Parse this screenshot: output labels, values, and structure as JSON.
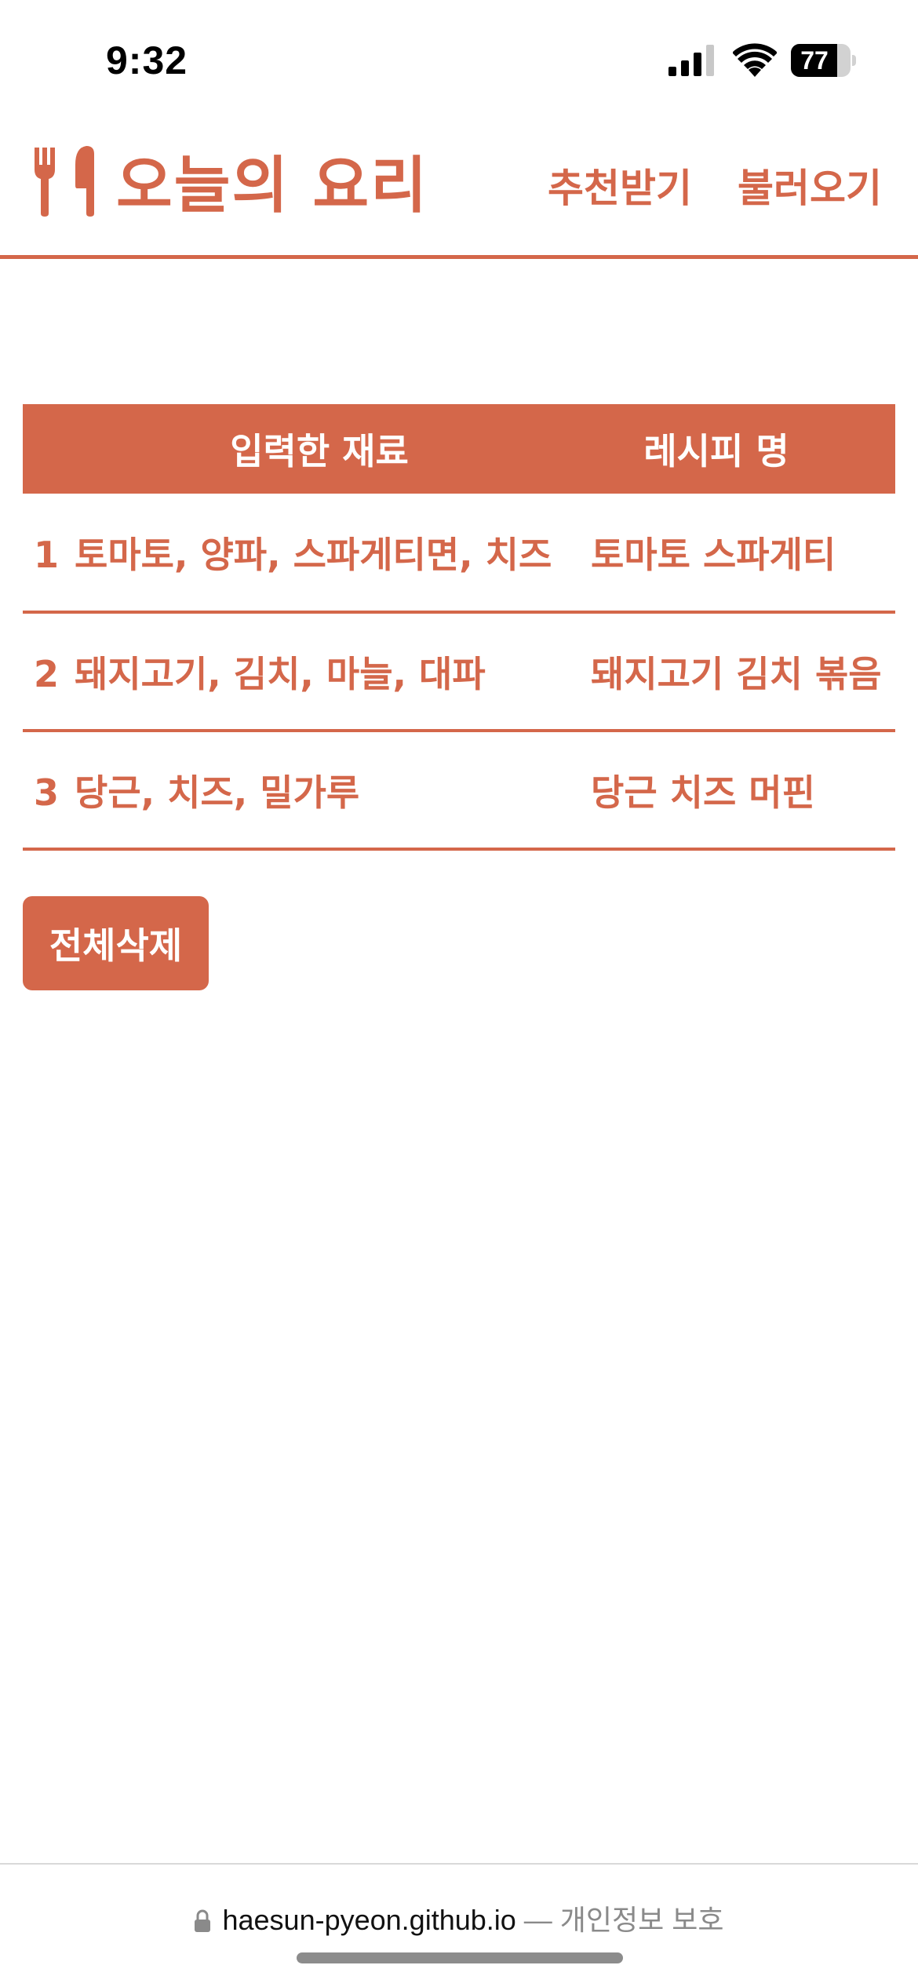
{
  "status_bar": {
    "time": "9:32",
    "battery": "77",
    "battery_level": 0.77
  },
  "header": {
    "title": "오늘의 요리",
    "nav": [
      {
        "label": "추천받기"
      },
      {
        "label": "불러오기"
      }
    ]
  },
  "table": {
    "headers": {
      "ingredients": "입력한 재료",
      "recipe": "레시피 명"
    },
    "rows": [
      {
        "num": "1",
        "ingredients": "토마토, 양파, 스파게티면, 치즈",
        "recipe": "토마토 스파게티"
      },
      {
        "num": "2",
        "ingredients": "돼지고기, 김치, 마늘, 대파",
        "recipe": "돼지고기 김치 볶음"
      },
      {
        "num": "3",
        "ingredients": "당근, 치즈, 밀가루",
        "recipe": "당근 치즈 머핀"
      }
    ]
  },
  "actions": {
    "delete_all": "전체삭제"
  },
  "browser": {
    "domain": "haesun-pyeon.github.io",
    "privacy": " — 개인정보 보호"
  },
  "colors": {
    "accent": "#d4674a",
    "background": "#ffffff"
  },
  "icons": {
    "logo": "fork-knife-icon",
    "lock": "lock-icon"
  }
}
